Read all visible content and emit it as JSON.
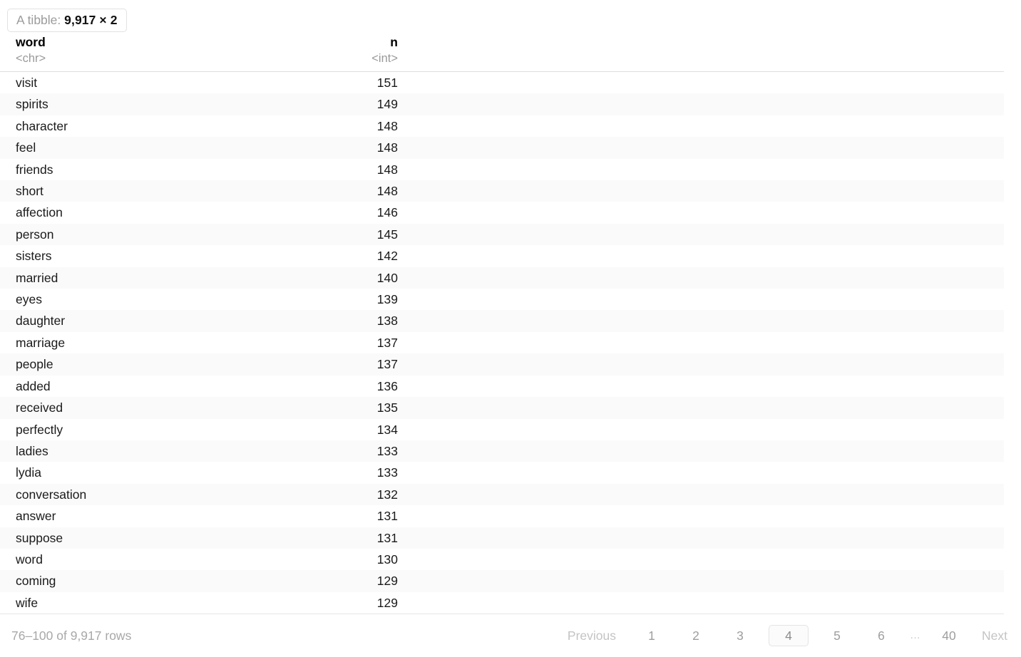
{
  "badge": {
    "label": "A tibble:",
    "dimensions": "9,917 × 2",
    "rows": 9917,
    "cols": 2
  },
  "table": {
    "columns": [
      {
        "name": "word",
        "type": "<chr>",
        "align": "left"
      },
      {
        "name": "n",
        "type": "<int>",
        "align": "right"
      }
    ],
    "rows": [
      {
        "word": "visit",
        "n": "151"
      },
      {
        "word": "spirits",
        "n": "149"
      },
      {
        "word": "character",
        "n": "148"
      },
      {
        "word": "feel",
        "n": "148"
      },
      {
        "word": "friends",
        "n": "148"
      },
      {
        "word": "short",
        "n": "148"
      },
      {
        "word": "affection",
        "n": "146"
      },
      {
        "word": "person",
        "n": "145"
      },
      {
        "word": "sisters",
        "n": "142"
      },
      {
        "word": "married",
        "n": "140"
      },
      {
        "word": "eyes",
        "n": "139"
      },
      {
        "word": "daughter",
        "n": "138"
      },
      {
        "word": "marriage",
        "n": "137"
      },
      {
        "word": "people",
        "n": "137"
      },
      {
        "word": "added",
        "n": "136"
      },
      {
        "word": "received",
        "n": "135"
      },
      {
        "word": "perfectly",
        "n": "134"
      },
      {
        "word": "ladies",
        "n": "133"
      },
      {
        "word": "lydia",
        "n": "133"
      },
      {
        "word": "conversation",
        "n": "132"
      },
      {
        "word": "answer",
        "n": "131"
      },
      {
        "word": "suppose",
        "n": "131"
      },
      {
        "word": "word",
        "n": "130"
      },
      {
        "word": "coming",
        "n": "129"
      },
      {
        "word": "wife",
        "n": "129"
      }
    ]
  },
  "footer": {
    "status": "76–100 of 9,917 rows",
    "pagination": {
      "previous_label": "Previous",
      "next_label": "Next",
      "ellipsis": "…",
      "active_page": "4",
      "pages": [
        "1",
        "2",
        "3",
        "4",
        "5",
        "6",
        "…",
        "40"
      ]
    }
  },
  "colors": {
    "stripe": "#fafafa",
    "rule": "#dedede",
    "muted_text": "#9a9a9a",
    "pagination_text": "#9e9e9e",
    "active_page_border": "#e4e4e4"
  }
}
